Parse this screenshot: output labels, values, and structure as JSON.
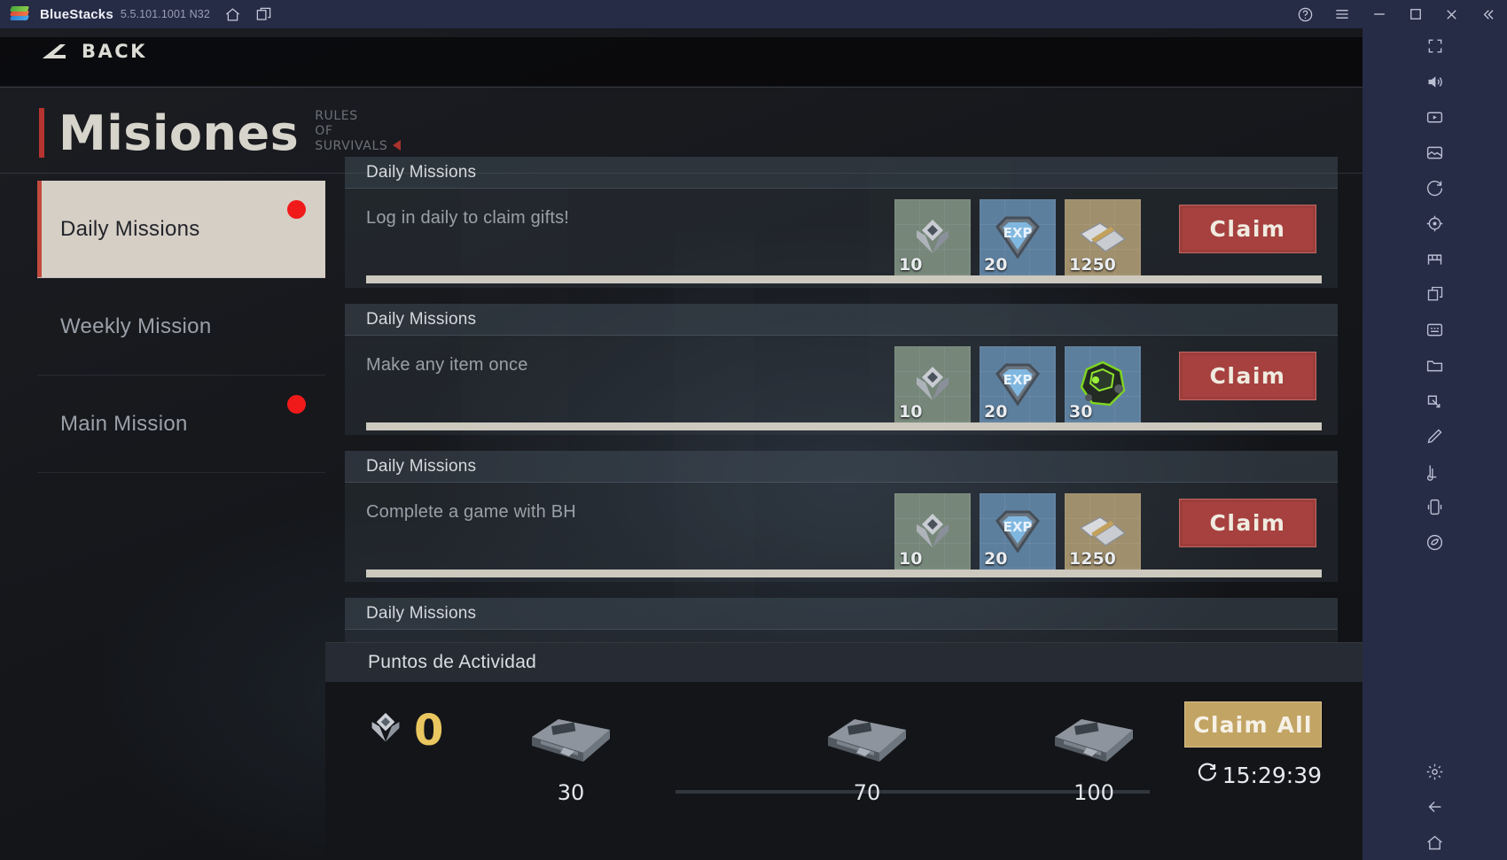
{
  "titlebar": {
    "app_name": "BlueStacks",
    "version": "5.5.101.1001 N32",
    "icons": {
      "home": "home-icon",
      "tabs": "multi-instance-icon",
      "help": "help-icon",
      "menu": "hamburger-menu-icon",
      "minimize": "minimize-icon",
      "maximize": "maximize-icon",
      "close": "close-icon",
      "collapse": "collapse-sidebar-icon"
    }
  },
  "game": {
    "back_label": "BACK",
    "page_title": "Misiones",
    "brand_lines": [
      "RULES",
      "OF",
      "SURVIVALS"
    ],
    "accent_red": "#b5342f",
    "sidebar": {
      "items": [
        {
          "label": "Daily Missions",
          "active": true,
          "badge": true
        },
        {
          "label": "Weekly Mission",
          "active": false,
          "badge": false
        },
        {
          "label": "Main Mission",
          "active": false,
          "badge": true
        }
      ]
    },
    "missions": [
      {
        "title": "Daily Missions",
        "description": "Log in daily to claim gifts!",
        "rewards": [
          {
            "icon": "rank-chevron-icon",
            "value": "10",
            "tone": "green"
          },
          {
            "icon": "exp-diamond-icon",
            "value": "20",
            "tone": "blue"
          },
          {
            "icon": "money-stack-icon",
            "value": "1250",
            "tone": "tan"
          }
        ],
        "button": "Claim",
        "progress": 100
      },
      {
        "title": "Daily Missions",
        "description": "Make any item once",
        "rewards": [
          {
            "icon": "rank-chevron-icon",
            "value": "10",
            "tone": "green"
          },
          {
            "icon": "exp-diamond-icon",
            "value": "20",
            "tone": "blue"
          },
          {
            "icon": "green-orb-icon",
            "value": "30",
            "tone": "blue"
          }
        ],
        "button": "Claim",
        "progress": 100
      },
      {
        "title": "Daily Missions",
        "description": "Complete a game with BH",
        "rewards": [
          {
            "icon": "rank-chevron-icon",
            "value": "10",
            "tone": "green"
          },
          {
            "icon": "exp-diamond-icon",
            "value": "20",
            "tone": "blue"
          },
          {
            "icon": "money-stack-icon",
            "value": "1250",
            "tone": "tan"
          }
        ],
        "button": "Claim",
        "progress": 100
      },
      {
        "title": "Daily Missions",
        "description": "",
        "rewards": [],
        "button": "",
        "progress": 0
      }
    ],
    "activity": {
      "title": "Puntos de Actividad",
      "points": "0",
      "points_color": "#e9c65f",
      "milestones": [
        {
          "label": "30",
          "icon": "crate-icon"
        },
        {
          "label": "70",
          "icon": "crate-icon"
        },
        {
          "label": "100",
          "icon": "crate-icon"
        }
      ],
      "claim_all_label": "Claim All",
      "claim_all_color": "#c2a464",
      "timer": "15:29:39",
      "timer_icon": "refresh-icon"
    }
  },
  "right_toolbar": {
    "items": [
      "fullscreen-icon",
      "volume-icon",
      "video-record-icon",
      "screenshot-icon",
      "rotate-icon",
      "location-icon",
      "game-controls-icon",
      "multi-instance-icon",
      "macro-icon",
      "folder-icon",
      "keymapping-icon",
      "edit-icon",
      "trim-icon",
      "shake-icon",
      "eco-mode-icon"
    ],
    "bottom_items": [
      "gear-icon",
      "back-arrow-icon",
      "home-icon"
    ]
  }
}
